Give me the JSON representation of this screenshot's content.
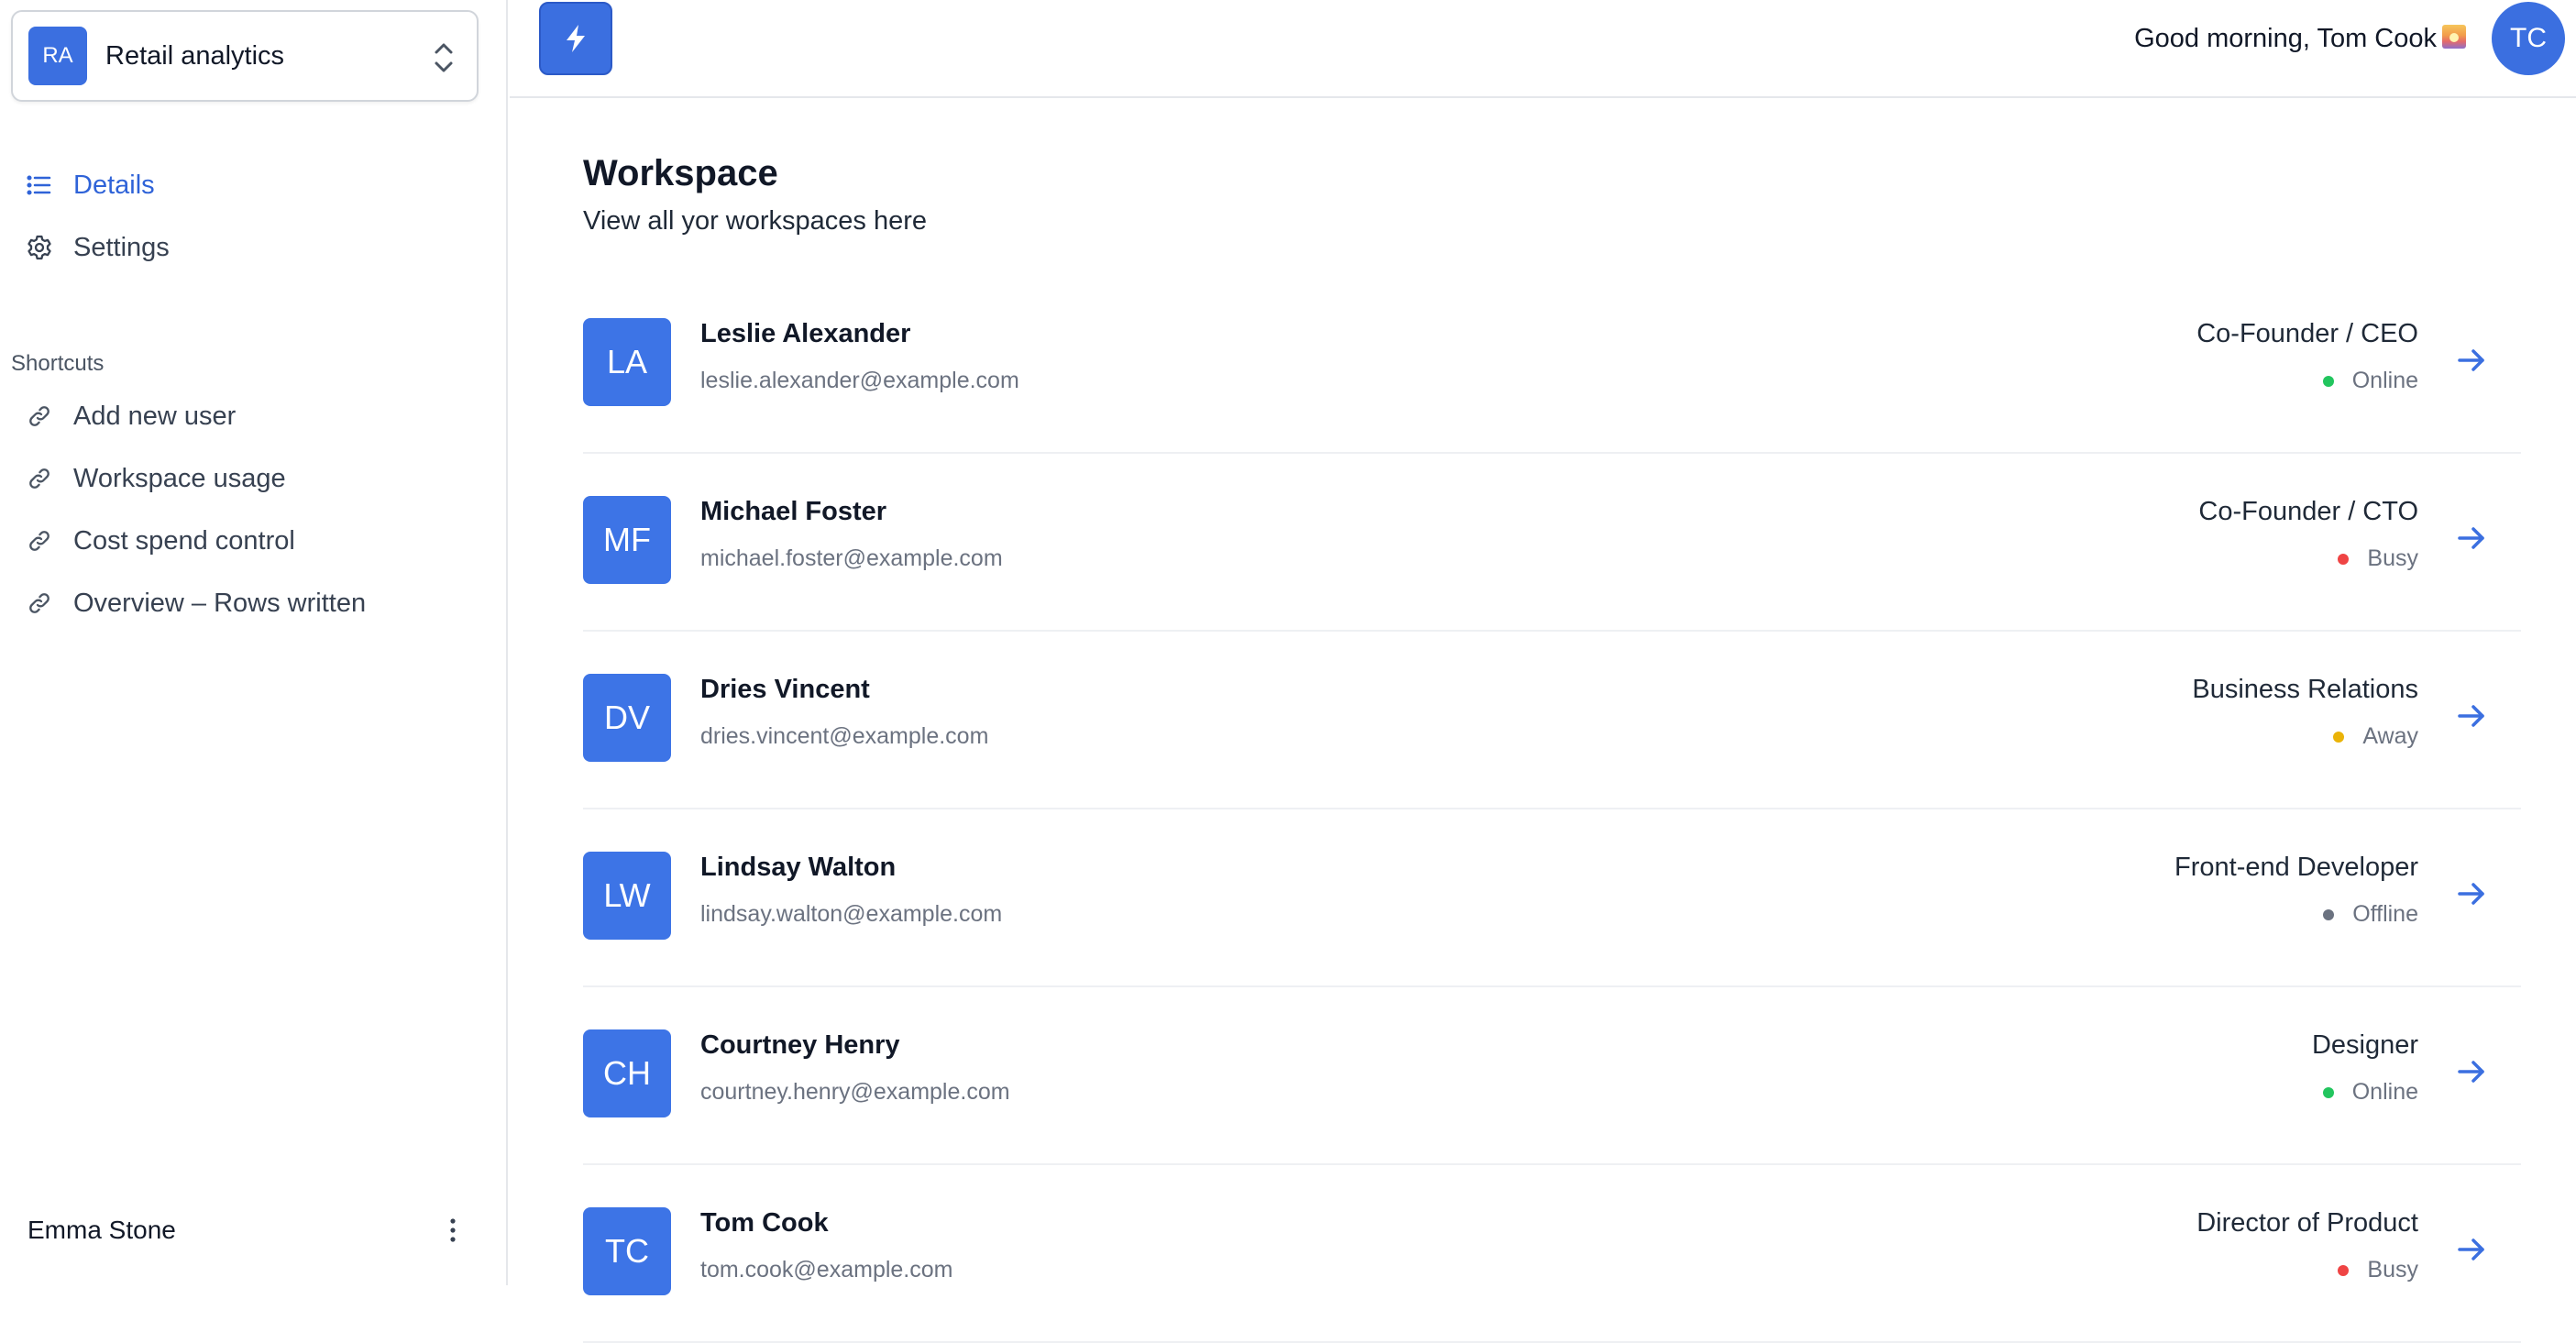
{
  "sidebar": {
    "team": {
      "initials": "RA",
      "name": "Retail analytics"
    },
    "nav": [
      {
        "label": "Details",
        "icon": "list-icon",
        "active": true
      },
      {
        "label": "Settings",
        "icon": "gear-icon",
        "active": false
      }
    ],
    "shortcuts_title": "Shortcuts",
    "shortcuts": [
      {
        "label": "Add new user",
        "icon": "link-icon"
      },
      {
        "label": "Workspace usage",
        "icon": "link-icon"
      },
      {
        "label": "Cost spend control",
        "icon": "link-icon"
      },
      {
        "label": "Overview – Rows written",
        "icon": "link-icon"
      }
    ],
    "user": {
      "name": "Emma Stone"
    }
  },
  "header": {
    "logo_icon": "bolt-icon",
    "greeting": "Good morning, Tom Cook",
    "greeting_emoji": "sunrise-emoji",
    "avatar_initials": "TC"
  },
  "main": {
    "title": "Workspace",
    "subtitle": "View all yor workspaces here",
    "people": [
      {
        "initials": "LA",
        "name": "Leslie Alexander",
        "email": "leslie.alexander@example.com",
        "role": "Co-Founder / CEO",
        "status": "Online",
        "status_color": "#22c55e"
      },
      {
        "initials": "MF",
        "name": "Michael Foster",
        "email": "michael.foster@example.com",
        "role": "Co-Founder / CTO",
        "status": "Busy",
        "status_color": "#ef4444"
      },
      {
        "initials": "DV",
        "name": "Dries Vincent",
        "email": "dries.vincent@example.com",
        "role": "Business Relations",
        "status": "Away",
        "status_color": "#eab308"
      },
      {
        "initials": "LW",
        "name": "Lindsay Walton",
        "email": "lindsay.walton@example.com",
        "role": "Front-end Developer",
        "status": "Offline",
        "status_color": "#6b7280"
      },
      {
        "initials": "CH",
        "name": "Courtney Henry",
        "email": "courtney.henry@example.com",
        "role": "Designer",
        "status": "Online",
        "status_color": "#22c55e"
      },
      {
        "initials": "TC",
        "name": "Tom Cook",
        "email": "tom.cook@example.com",
        "role": "Director of Product",
        "status": "Busy",
        "status_color": "#ef4444"
      }
    ]
  },
  "colors": {
    "accent": "#3b6fe0",
    "active_nav": "#2f63d8"
  }
}
